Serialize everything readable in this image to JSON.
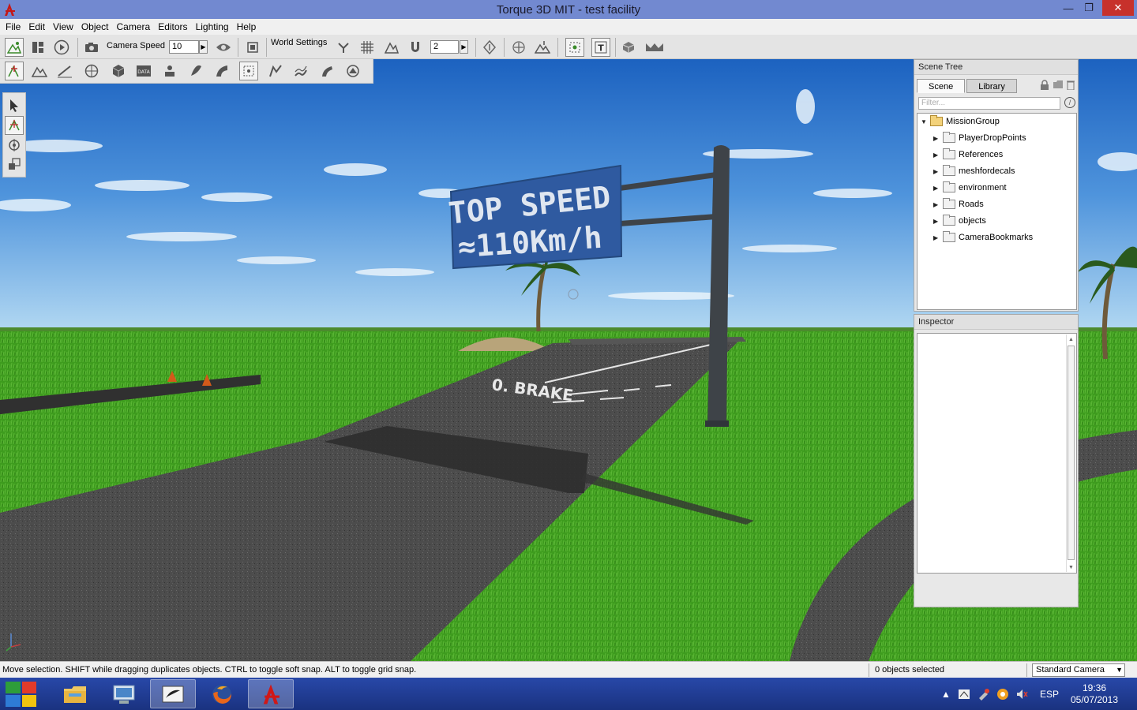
{
  "window": {
    "title": "Torque 3D MIT - test facility",
    "min_label": "—",
    "max_label": "❐",
    "close_label": "✕"
  },
  "menu": [
    "File",
    "Edit",
    "View",
    "Object",
    "Camera",
    "Editors",
    "Lighting",
    "Help"
  ],
  "toolbar": {
    "camera_speed_label": "Camera Speed",
    "camera_speed_value": "10",
    "world_settings_label": "World Settings",
    "snap_value": "2"
  },
  "viewport": {
    "sign_line1": "TOP SPEED",
    "sign_line2": "≈110Km/h",
    "road_marking": "0. BRAKE"
  },
  "scene_tree": {
    "title": "Scene Tree",
    "tabs": [
      "Scene",
      "Library"
    ],
    "active_tab": "Scene",
    "filter_placeholder": "Filter...",
    "root": "MissionGroup",
    "children": [
      "PlayerDropPoints",
      "References",
      "meshfordecals",
      "environment",
      "Roads",
      "objects",
      "CameraBookmarks"
    ]
  },
  "inspector": {
    "title": "Inspector"
  },
  "status": {
    "message": "Move selection.  SHIFT while dragging duplicates objects.  CTRL to toggle soft snap.  ALT to toggle grid snap.",
    "selection": "0 objects selected",
    "camera_mode": "Standard Camera"
  },
  "taskbar": {
    "language": "ESP",
    "time": "19:36",
    "date": "05/07/2013"
  },
  "colors": {
    "titlebar": "#7289d0",
    "close_button": "#c7312b",
    "sign_blue": "#2f5aa0",
    "grass": "#3c9a1c",
    "asphalt": "#4a4a4a",
    "sky_top": "#1c62c0",
    "sky_bottom": "#a9d3f2"
  }
}
